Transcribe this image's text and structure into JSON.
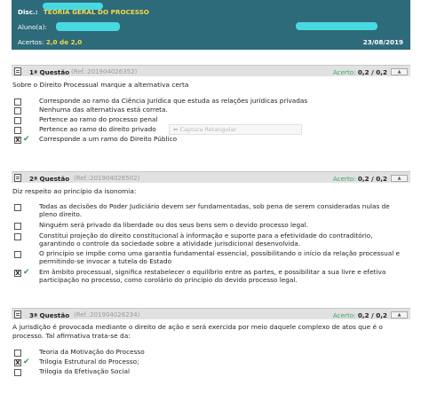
{
  "header": {
    "disc_label": "Disc.:",
    "disc_value": "TEORIA GERAL DO PROCESSO",
    "student_label": "Aluno(a):",
    "hits_label": "Acertos:",
    "hits_value": "2,0 de 2,0",
    "date": "23/08/2019",
    "colors": {
      "background": "#2d6a7a",
      "accent": "#f5d94a",
      "redaction": "#49d9e0"
    }
  },
  "tooltip": "Captura Retangular",
  "questions": [
    {
      "title": "1ª Questão",
      "ref": "(Ref.:201904026352)",
      "score_label": "Acerto:",
      "score": "0,2 / 0,2",
      "statement": "Sobre o Direito Processual marque a alternativa certa",
      "options": [
        {
          "text": "Corresponde ao ramo da Ciência Jurídica que estuda as relações jurídicas privadas",
          "mark": ""
        },
        {
          "text": "Nenhuma das alternativas está correta.",
          "mark": ""
        },
        {
          "text": "Pertence ao ramo do processo penal",
          "mark": ""
        },
        {
          "text": "Pertence ao ramo do direito privado",
          "mark": ""
        },
        {
          "text": "Corresponde a um ramo do Direito Público",
          "mark": "X"
        }
      ]
    },
    {
      "title": "2ª Questão",
      "ref": "(Ref.:201904026502)",
      "score_label": "Acerto:",
      "score": "0,2 / 0,2",
      "statement": "Diz respeito ao princípio da isonomia:",
      "options": [
        {
          "text": "Todas as decisões do Poder Judiciário devem ser fundamentadas, sob pena de serem consideradas nulas de pleno direito.",
          "mark": ""
        },
        {
          "text": "Ninguém será privado da liberdade ou dos seus bens sem o devido processo legal.",
          "mark": ""
        },
        {
          "text": "Constitui projeção do direito constitucional à informação e suporte para a efetividade do contraditório, garantindo o controle da sociedade sobre a atividade jurisdicional desenvolvida.",
          "mark": ""
        },
        {
          "text": "O princípio se impõe como uma garantia fundamental essencial, possibilitando o início da relação processual e permitindo-se invocar a tutela do Estado",
          "mark": ""
        },
        {
          "text": "Em âmbito processual, significa restabelecer o equilíbrio entre as partes, e possibilitar a sua livre e efetiva participação no processo, como corolário do princípio do devido processo legal.",
          "mark": "X"
        }
      ]
    },
    {
      "title": "3ª Questão",
      "ref": "(Ref.:201904026234)",
      "score_label": "Acerto:",
      "score": "0,2 / 0,2",
      "statement": "A jurisdição é provocada mediante o direito de ação e será exercida por meio daquele complexo de atos que é o processo. Tal afirmativa trata-se da:",
      "options": [
        {
          "text": "Teoria da Motivação do Processo",
          "mark": ""
        },
        {
          "text": "Trilogia Estrutural do Processo;",
          "mark": "X"
        },
        {
          "text": "Trilogia da Efetivação Social",
          "mark": ""
        }
      ]
    }
  ]
}
